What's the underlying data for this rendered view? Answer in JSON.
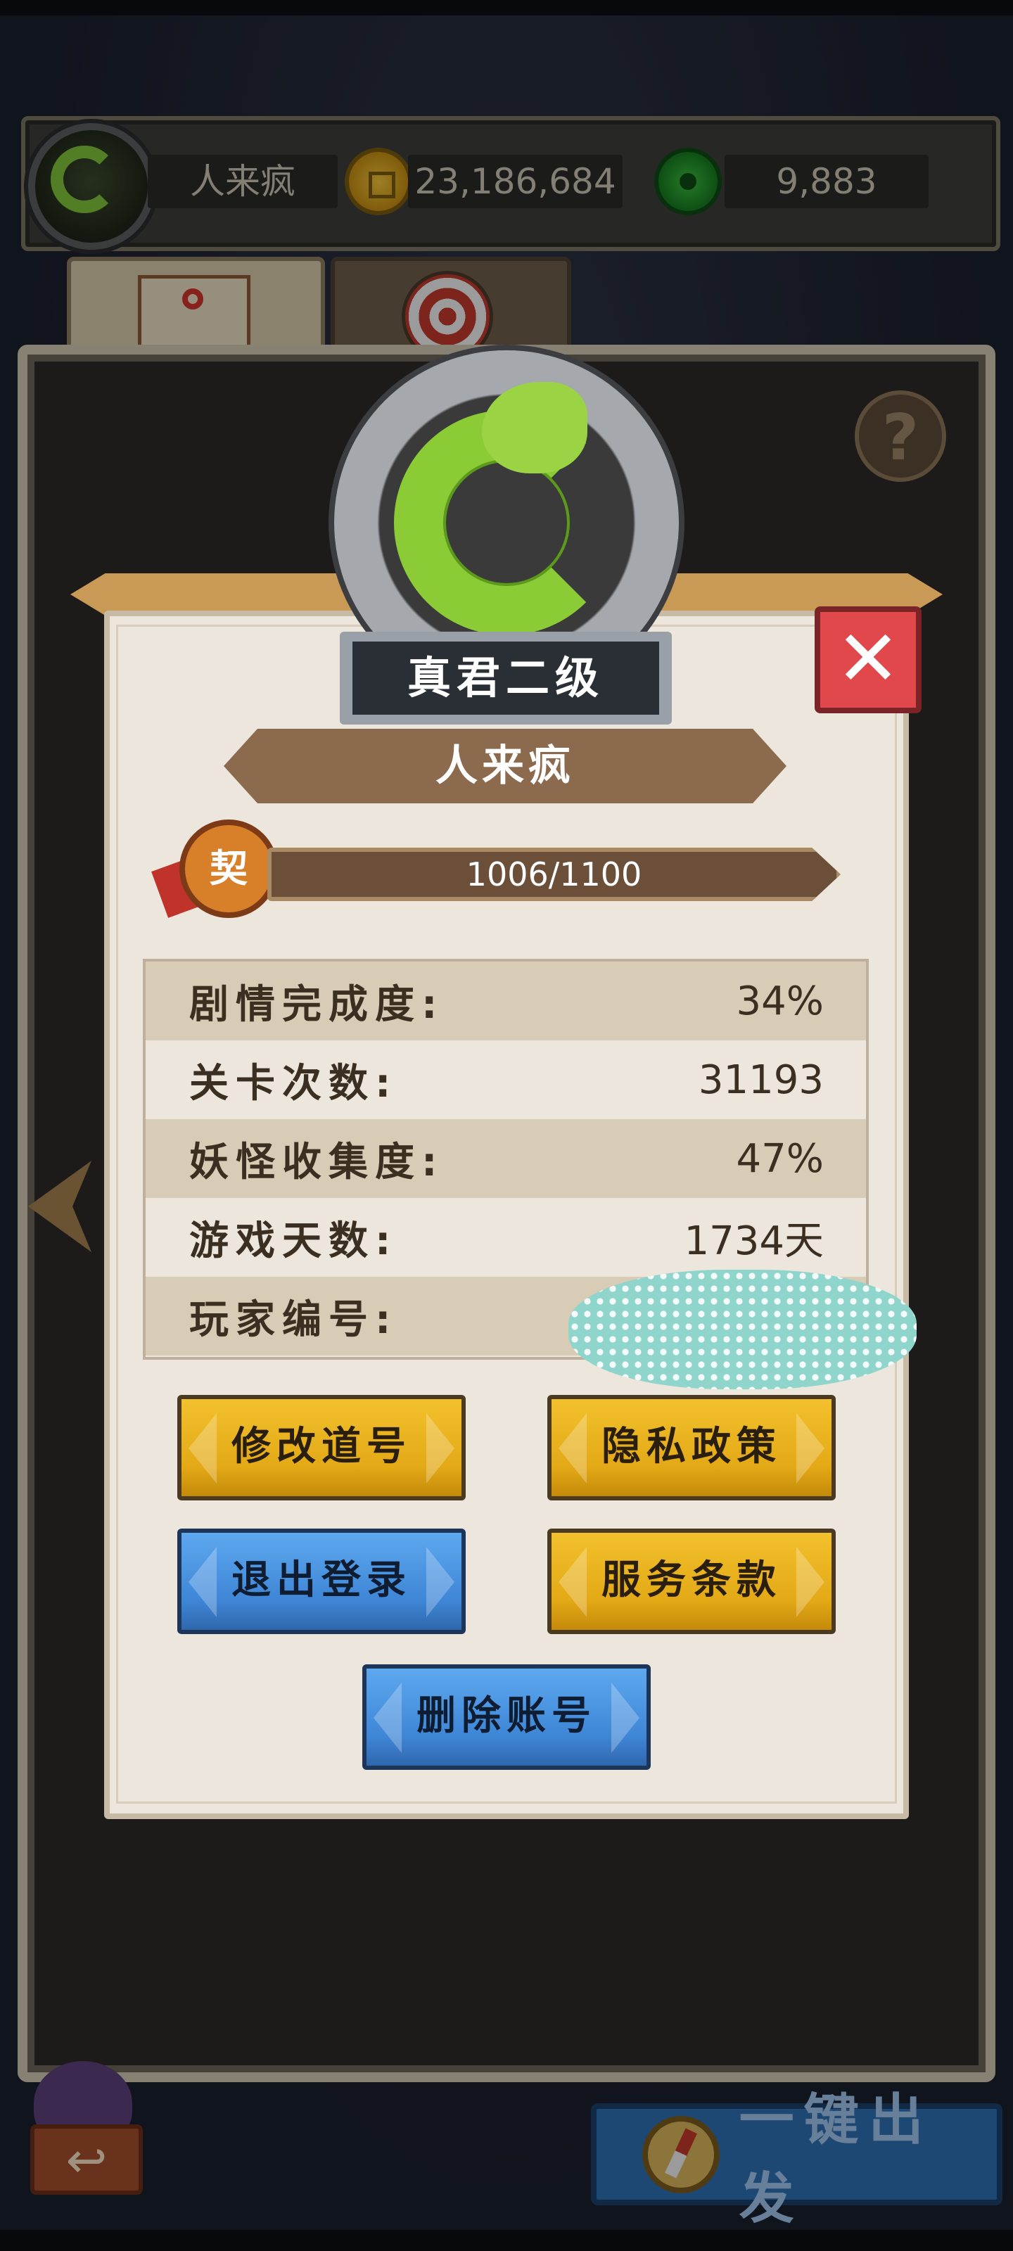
{
  "topbar": {
    "player_name": "人来疯",
    "gold": "23,186,684",
    "jade": "9,883",
    "icons": [
      "player-avatar-icon",
      "gold-coin-icon",
      "jade-coin-icon"
    ]
  },
  "tabs": [
    {
      "icon": "map-icon"
    },
    {
      "icon": "target-icon"
    }
  ],
  "help": {
    "label": "?"
  },
  "modal": {
    "rank": "真君二级",
    "name": "人来疯",
    "close_label": "✕",
    "pact_badge": "契",
    "progress": {
      "text": "1006/1100",
      "current": 1006,
      "max": 1100
    },
    "stats": [
      {
        "key": "剧情完成度:",
        "value": "34%"
      },
      {
        "key": "关卡次数:",
        "value": "31193"
      },
      {
        "key": "妖怪收集度:",
        "value": "47%"
      },
      {
        "key": "游戏天数:",
        "value": "1734天"
      },
      {
        "key": "玩家编号:",
        "value": ""
      }
    ],
    "buttons": {
      "rename": "修改道号",
      "privacy": "隐私政策",
      "logout": "退出登录",
      "terms": "服务条款",
      "delete": "删除账号"
    }
  },
  "bottom": {
    "back_label": "↩",
    "depart_label": "一键出发"
  },
  "colors": {
    "yellow_button": "#e3a916",
    "blue_button": "#3e86d6",
    "close_button": "#e0484b",
    "jade_green": "#8acb36"
  }
}
